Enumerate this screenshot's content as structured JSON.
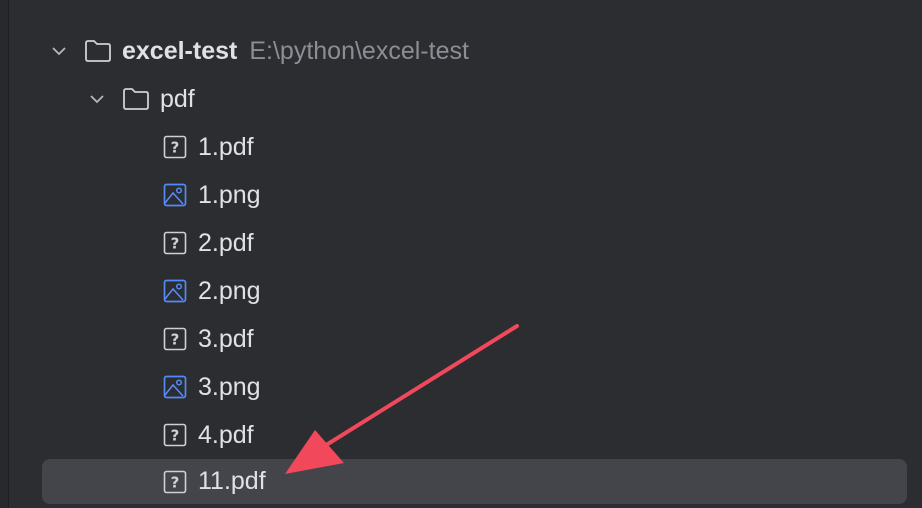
{
  "project": {
    "name": "excel-test",
    "path": "E:\\python\\excel-test",
    "icon": "folder-icon"
  },
  "folder": {
    "name": "pdf",
    "icon": "folder-icon"
  },
  "files": [
    {
      "name": "1.pdf",
      "icon": "unknown-file-icon"
    },
    {
      "name": "1.png",
      "icon": "image-file-icon"
    },
    {
      "name": "2.pdf",
      "icon": "unknown-file-icon"
    },
    {
      "name": "2.png",
      "icon": "image-file-icon"
    },
    {
      "name": "3.pdf",
      "icon": "unknown-file-icon"
    },
    {
      "name": "3.png",
      "icon": "image-file-icon"
    },
    {
      "name": "4.pdf",
      "icon": "unknown-file-icon"
    },
    {
      "name": "11.pdf",
      "icon": "unknown-file-icon",
      "selected": true
    }
  ],
  "colors": {
    "background": "#2b2d30",
    "selection": "#43454a",
    "text": "#dfe1e5",
    "path_text": "#8b8e94",
    "image_icon": "#548af7",
    "annotation_arrow": "#f2485c"
  }
}
